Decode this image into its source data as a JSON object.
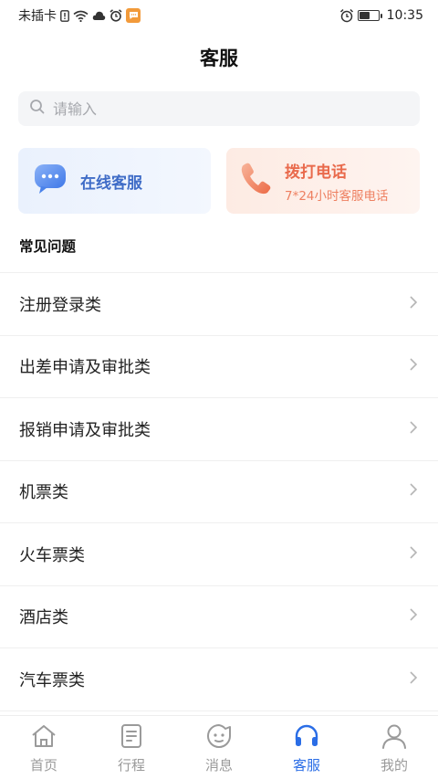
{
  "status_bar": {
    "carrier": "未插卡",
    "time": "10:35",
    "battery_level": 0.55
  },
  "header": {
    "title": "客服"
  },
  "search": {
    "placeholder": "请输入"
  },
  "cards": {
    "online": {
      "title": "在线客服",
      "icon": "chat-bubble-icon",
      "accent": "#3f6cc7"
    },
    "phone": {
      "title": "拨打电话",
      "subtitle": "7*24小时客服电话",
      "icon": "phone-icon",
      "accent": "#e96a4c"
    }
  },
  "faq": {
    "section_title": "常见问题",
    "items": [
      {
        "label": "注册登录类"
      },
      {
        "label": "出差申请及审批类"
      },
      {
        "label": "报销申请及审批类"
      },
      {
        "label": "机票类"
      },
      {
        "label": "火车票类"
      },
      {
        "label": "酒店类"
      },
      {
        "label": "汽车票类"
      }
    ]
  },
  "tabbar": {
    "active_color": "#2a6de6",
    "tabs": [
      {
        "label": "首页",
        "icon": "home-icon",
        "active": false
      },
      {
        "label": "行程",
        "icon": "itinerary-icon",
        "active": false
      },
      {
        "label": "消息",
        "icon": "message-icon",
        "active": false
      },
      {
        "label": "客服",
        "icon": "headset-icon",
        "active": true
      },
      {
        "label": "我的",
        "icon": "profile-icon",
        "active": false
      }
    ]
  }
}
